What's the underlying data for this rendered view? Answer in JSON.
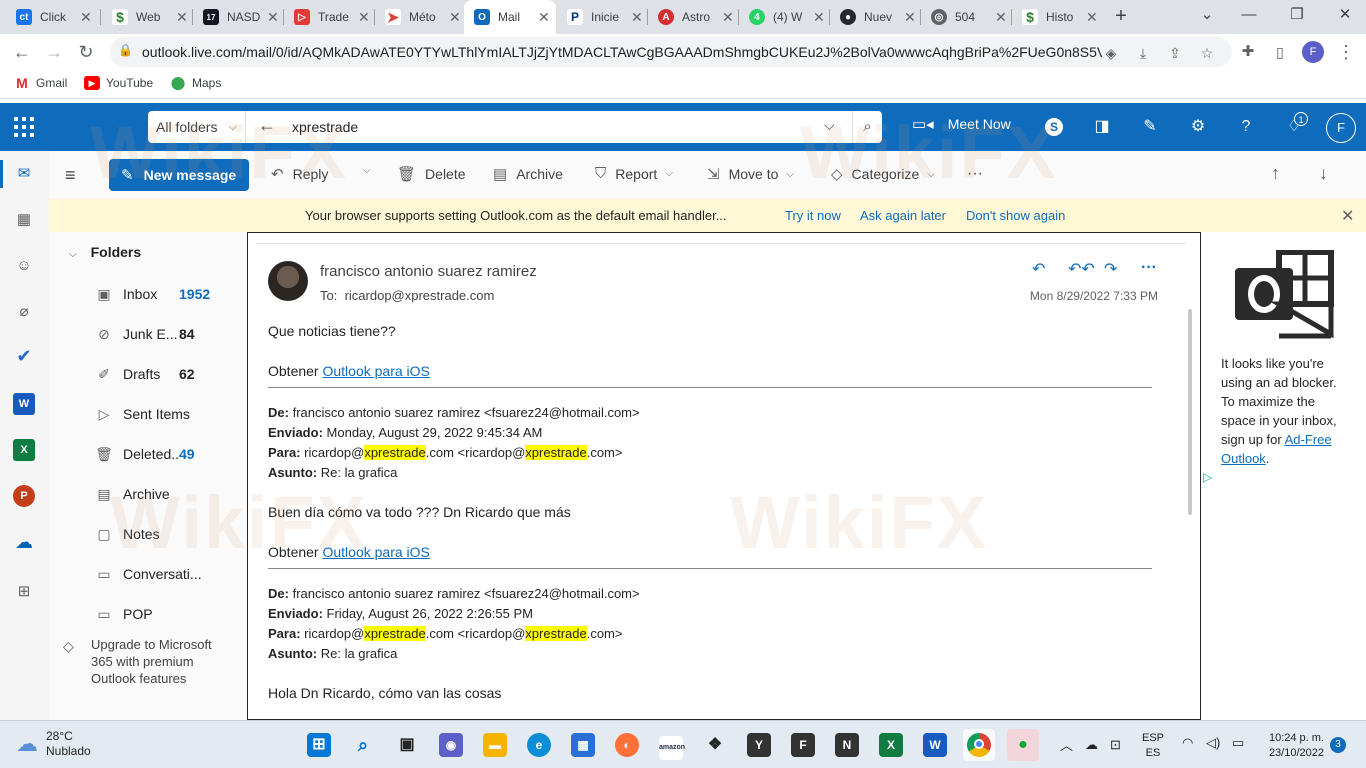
{
  "browser": {
    "tabs": [
      {
        "label": "Click",
        "icon": "ct-icon",
        "color": "#1a73e8"
      },
      {
        "label": "Web",
        "icon": "dollar-icon",
        "color": "#2e7d32"
      },
      {
        "label": "NASD",
        "icon": "tv-icon",
        "color": "#131722"
      },
      {
        "label": "Trade",
        "icon": "play-icon",
        "color": "#e53935"
      },
      {
        "label": "Méto",
        "icon": "arrow-icon",
        "color": "#e53935"
      },
      {
        "label": "Mail",
        "icon": "outlook-icon",
        "color": "#0f6cbd"
      },
      {
        "label": "Inicie",
        "icon": "paypal-icon",
        "color": "#003087"
      },
      {
        "label": "Astro",
        "icon": "a-icon",
        "color": "#d32f2f"
      },
      {
        "label": "(4) W",
        "icon": "whatsapp-icon",
        "color": "#25d366"
      },
      {
        "label": "Nuev",
        "icon": "github-icon",
        "color": "#24292f"
      },
      {
        "label": "504",
        "icon": "globe-icon",
        "color": "#5f6368"
      },
      {
        "label": "Histo",
        "icon": "dollar-icon",
        "color": "#2e7d32"
      }
    ],
    "url": "outlook.live.com/mail/0/id/AQMkADAwATE0YTYwLThlYmIALTJjZjYtMDACLTAwCgBGAAADmShmgbCUKEu2J%2BolVa0wwwcAqhgBriPa%2FUeG0n8S5V3%...",
    "profile_initial": "F",
    "bookmarks": [
      {
        "label": "Gmail",
        "icon": "gmail-icon"
      },
      {
        "label": "YouTube",
        "icon": "youtube-icon"
      },
      {
        "label": "Maps",
        "icon": "maps-icon"
      }
    ]
  },
  "owa": {
    "search": {
      "scope": "All folders",
      "query": "xprestrade"
    },
    "meet_now": "Meet Now",
    "bell_count": "1",
    "avatar_initial": "F",
    "commands": {
      "new_message": "New message",
      "reply": "Reply",
      "delete": "Delete",
      "archive": "Archive",
      "report": "Report",
      "move_to": "Move to",
      "categorize": "Categorize",
      "more": "···"
    },
    "infobar": {
      "message": "Your browser supports setting Outlook.com as the default email handler...",
      "try_it": "Try it now",
      "ask_later": "Ask again later",
      "dont_show": "Don't show again"
    },
    "folders_header": "Folders",
    "folders": [
      {
        "name": "Inbox",
        "count": "1952",
        "icon": "inbox-icon",
        "count_style": "blue"
      },
      {
        "name": "Junk E...",
        "count": "84",
        "icon": "junk-icon",
        "count_style": "bold"
      },
      {
        "name": "Drafts",
        "count": "62",
        "icon": "drafts-icon",
        "count_style": "bold"
      },
      {
        "name": "Sent Items",
        "count": "",
        "icon": "sent-icon",
        "count_style": ""
      },
      {
        "name": "Deleted...",
        "count": "49",
        "icon": "trash-icon",
        "count_style": "blue"
      },
      {
        "name": "Archive",
        "count": "",
        "icon": "archive-icon",
        "count_style": ""
      },
      {
        "name": "Notes",
        "count": "",
        "icon": "notes-icon",
        "count_style": ""
      },
      {
        "name": "Conversati...",
        "count": "",
        "icon": "folder-icon",
        "count_style": ""
      },
      {
        "name": "POP",
        "count": "",
        "icon": "folder-icon",
        "count_style": ""
      }
    ],
    "upgrade_text": "Upgrade to Microsoft 365 with premium Outlook features",
    "message": {
      "sender": "francisco antonio suarez ramirez",
      "to_label": "To:",
      "to": "ricardop@xprestrade.com",
      "date": "Mon 8/29/2022 7:33 PM",
      "line1": "Que noticias tiene??",
      "obtener": "Obtener",
      "outlook_ios": "Outlook para iOS",
      "quote1": {
        "de_label": "De:",
        "de": "francisco antonio suarez ramirez <fsuarez24@hotmail.com>",
        "enviado_label": "Enviado:",
        "enviado": "Monday, August 29, 2022 9:45:34 AM",
        "para_label": "Para:",
        "asunto_label": "Asunto:",
        "asunto": "Re: la grafica"
      },
      "line2": "Buen día cómo va todo ??? Dn Ricardo que más",
      "quote2": {
        "de_label": "De:",
        "de": "francisco antonio suarez ramirez <fsuarez24@hotmail.com>",
        "enviado_label": "Enviado:",
        "enviado": "Friday, August 26, 2022 2:26:55 PM",
        "para_label": "Para:",
        "asunto_label": "Asunto:",
        "asunto": "Re: la grafica"
      },
      "para_parts": [
        "ricardop@",
        "xprestrade",
        ".com <ricardop@",
        "xprestrade",
        ".com>"
      ],
      "line3": "Hola Dn Ricardo, cómo van las cosas"
    },
    "ad": {
      "text": "It looks like you're using an ad blocker. To maximize the space in your inbox, sign up for",
      "link": "Ad-Free Outlook",
      "end": "."
    }
  },
  "taskbar": {
    "weather_temp": "28°C",
    "weather_desc": "Nublado",
    "lang_top": "ESP",
    "lang_bottom": "ES",
    "time": "10:24 p. m.",
    "date": "23/10/2022",
    "notifications": "3"
  },
  "watermark": "WikiFX"
}
